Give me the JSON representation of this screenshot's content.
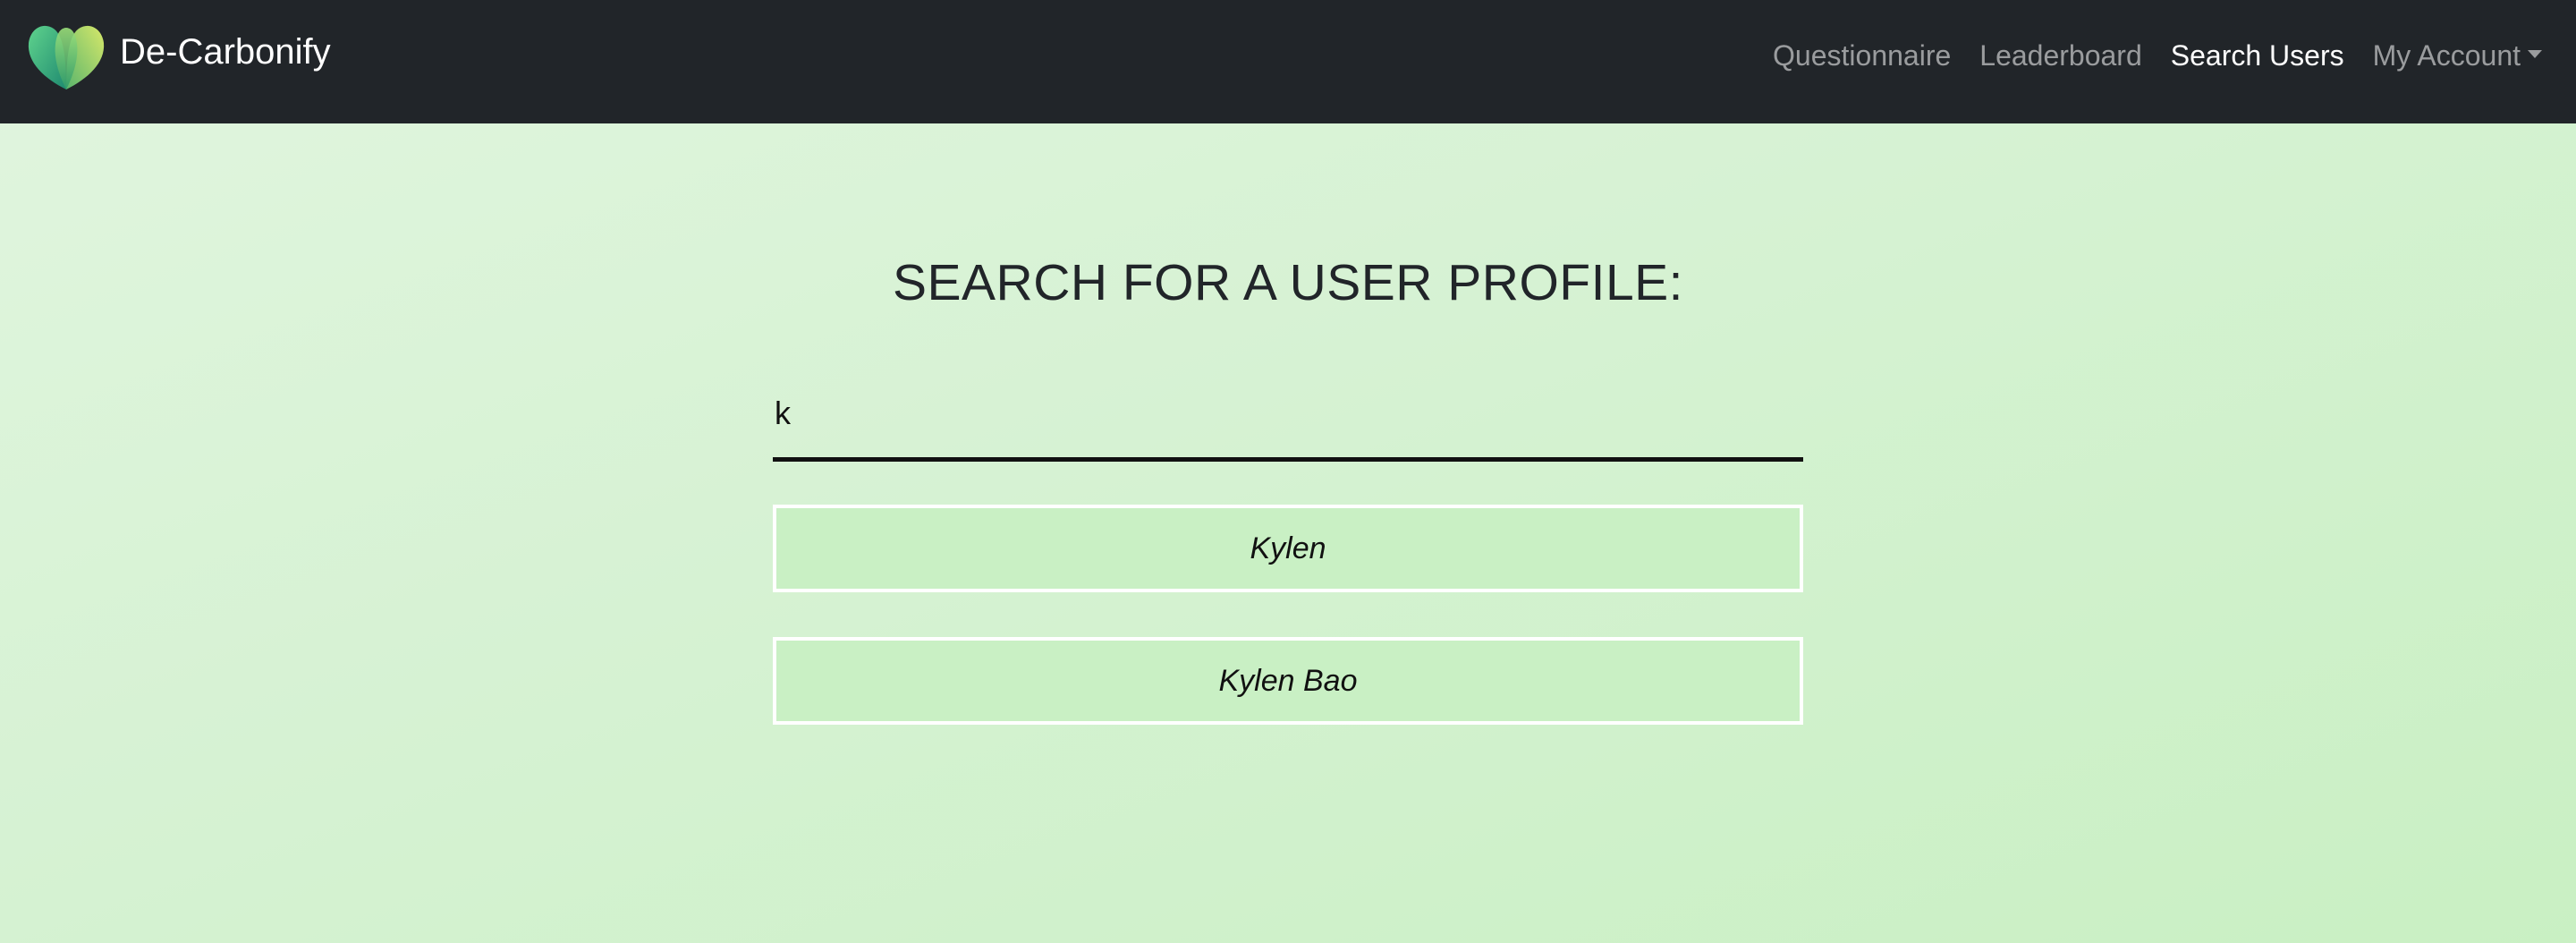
{
  "navbar": {
    "brand_name": "De-Carbonify",
    "brand_logo_icon": "leaf-heart-icon",
    "links": [
      {
        "label": "Questionnaire",
        "active": false
      },
      {
        "label": "Leaderboard",
        "active": false
      },
      {
        "label": "Search Users",
        "active": true
      },
      {
        "label": "My Account",
        "active": false,
        "dropdown": true
      }
    ]
  },
  "main": {
    "title": "SEARCH FOR A USER PROFILE:",
    "search": {
      "value": "k",
      "placeholder": ""
    },
    "results": [
      {
        "name": "Kylen"
      },
      {
        "name": "Kylen Bao"
      }
    ]
  },
  "colors": {
    "navbar_bg": "#212529",
    "page_bg_start": "#e1f5df",
    "page_bg_end": "#c9f0c3",
    "result_bg": "#c9f0c4",
    "result_border": "#ffffff"
  }
}
